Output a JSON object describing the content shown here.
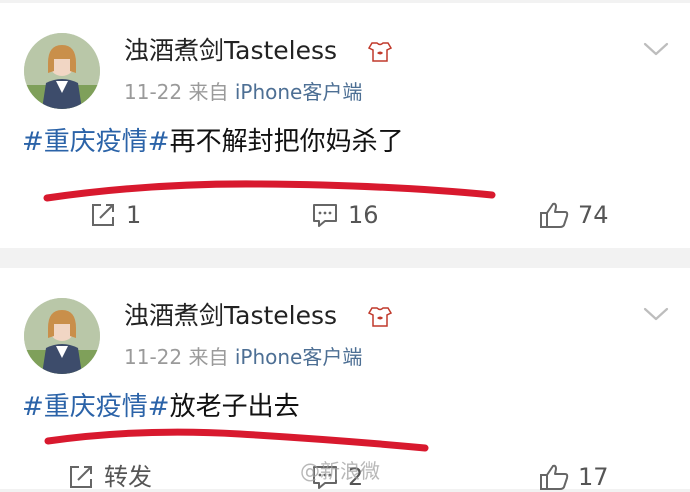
{
  "posts": [
    {
      "username": "浊酒煮剑Tasteless",
      "date": "11-22",
      "source_prefix": "来自",
      "source_client": "iPhone客户端",
      "hashtag": "#重庆疫情#",
      "text": "再不解封把你妈杀了",
      "repost_count": "1",
      "comment_count": "16",
      "like_count": "74",
      "underline_color": "#d8192e"
    },
    {
      "username": "浊酒煮剑Tasteless",
      "date": "11-22",
      "source_prefix": "来自",
      "source_client": "iPhone客户端",
      "hashtag": "#重庆疫情#",
      "text": "放老子出去",
      "repost_label": "转发",
      "comment_count": "2",
      "like_count": "17",
      "underline_color": "#d8192e"
    }
  ],
  "watermark": "@新浪微",
  "colors": {
    "hashtag": "#2b63a8",
    "source_client": "#4d6f94",
    "meta_gray": "#9a9a9a",
    "separator": "#f2f2f2"
  },
  "icons": [
    "avatar-photo",
    "vip-badge-icon",
    "chevron-down-icon",
    "repost-icon",
    "comment-icon",
    "like-icon"
  ]
}
